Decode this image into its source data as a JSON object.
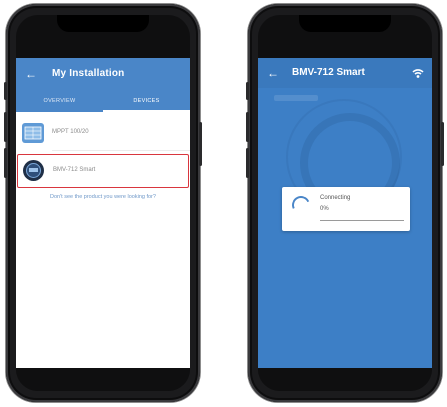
{
  "left_phone": {
    "appbar": {
      "back_icon": "arrow-left-icon",
      "title": "My Installation"
    },
    "tabs": [
      {
        "label": "OVERVIEW",
        "active": false
      },
      {
        "label": "DEVICES",
        "active": true
      }
    ],
    "devices": [
      {
        "name": "MPPT 100/20",
        "icon": "solar-charger-icon",
        "selected": false
      },
      {
        "name": "BMV-712 Smart",
        "icon": "battery-monitor-icon",
        "selected": true
      }
    ],
    "missing_link": "Don't see the product you were looking for?"
  },
  "right_phone": {
    "appbar": {
      "back_icon": "arrow-left-icon",
      "title": "BMV-712 Smart",
      "status_icon": "bluetooth-signal-icon"
    },
    "dialog": {
      "title": "Connecting",
      "progress_text": "0%",
      "progress": 0
    }
  },
  "colors": {
    "primary": "#4a86c8",
    "screen_blue": "#3d7fc6",
    "highlight": "#d9363e",
    "link": "#6f98c8"
  }
}
